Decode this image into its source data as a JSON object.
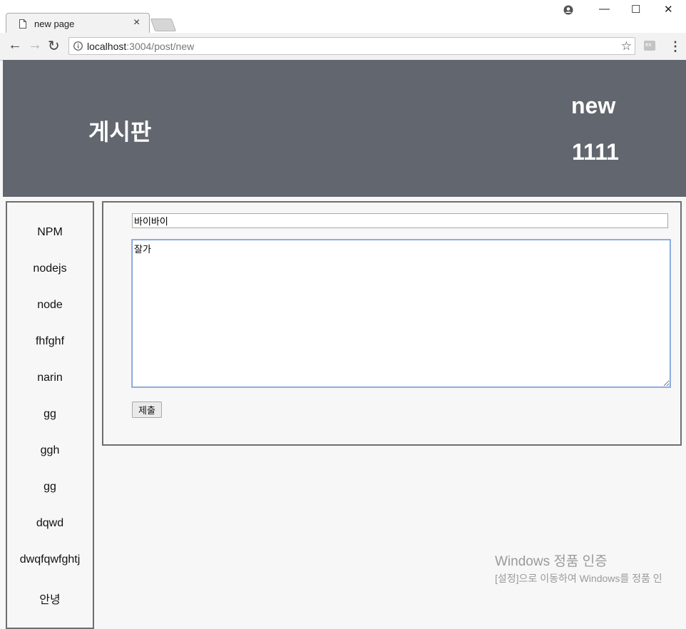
{
  "browser": {
    "tab_title": "new page",
    "tab_close": "×",
    "url_host": "localhost",
    "url_path": ":3004/post/new",
    "window_controls": {
      "minimize": "—",
      "maximize": "☐",
      "close": "✕"
    },
    "nav": {
      "back": "←",
      "forward": "→",
      "reload": "↻"
    },
    "star": "☆",
    "menu": "⋮",
    "extension_label": "ex"
  },
  "header": {
    "site_title": "게시판",
    "user_name": "new",
    "user_id": "1111"
  },
  "sidebar": {
    "items": [
      {
        "label": "NPM"
      },
      {
        "label": "nodejs"
      },
      {
        "label": "node"
      },
      {
        "label": "fhfghf"
      },
      {
        "label": "narin"
      },
      {
        "label": "gg"
      },
      {
        "label": "ggh"
      },
      {
        "label": "gg"
      },
      {
        "label": "dqwd"
      },
      {
        "label": "dwqfqwfghtj"
      },
      {
        "label": "안녕"
      }
    ]
  },
  "form": {
    "title_value": "바이바이",
    "body_value": "잘가",
    "submit_label": "제출"
  },
  "watermark": {
    "line1": "Windows 정품 인증",
    "line2": "[설정]으로 이동하여 Windows를 정품 인"
  }
}
